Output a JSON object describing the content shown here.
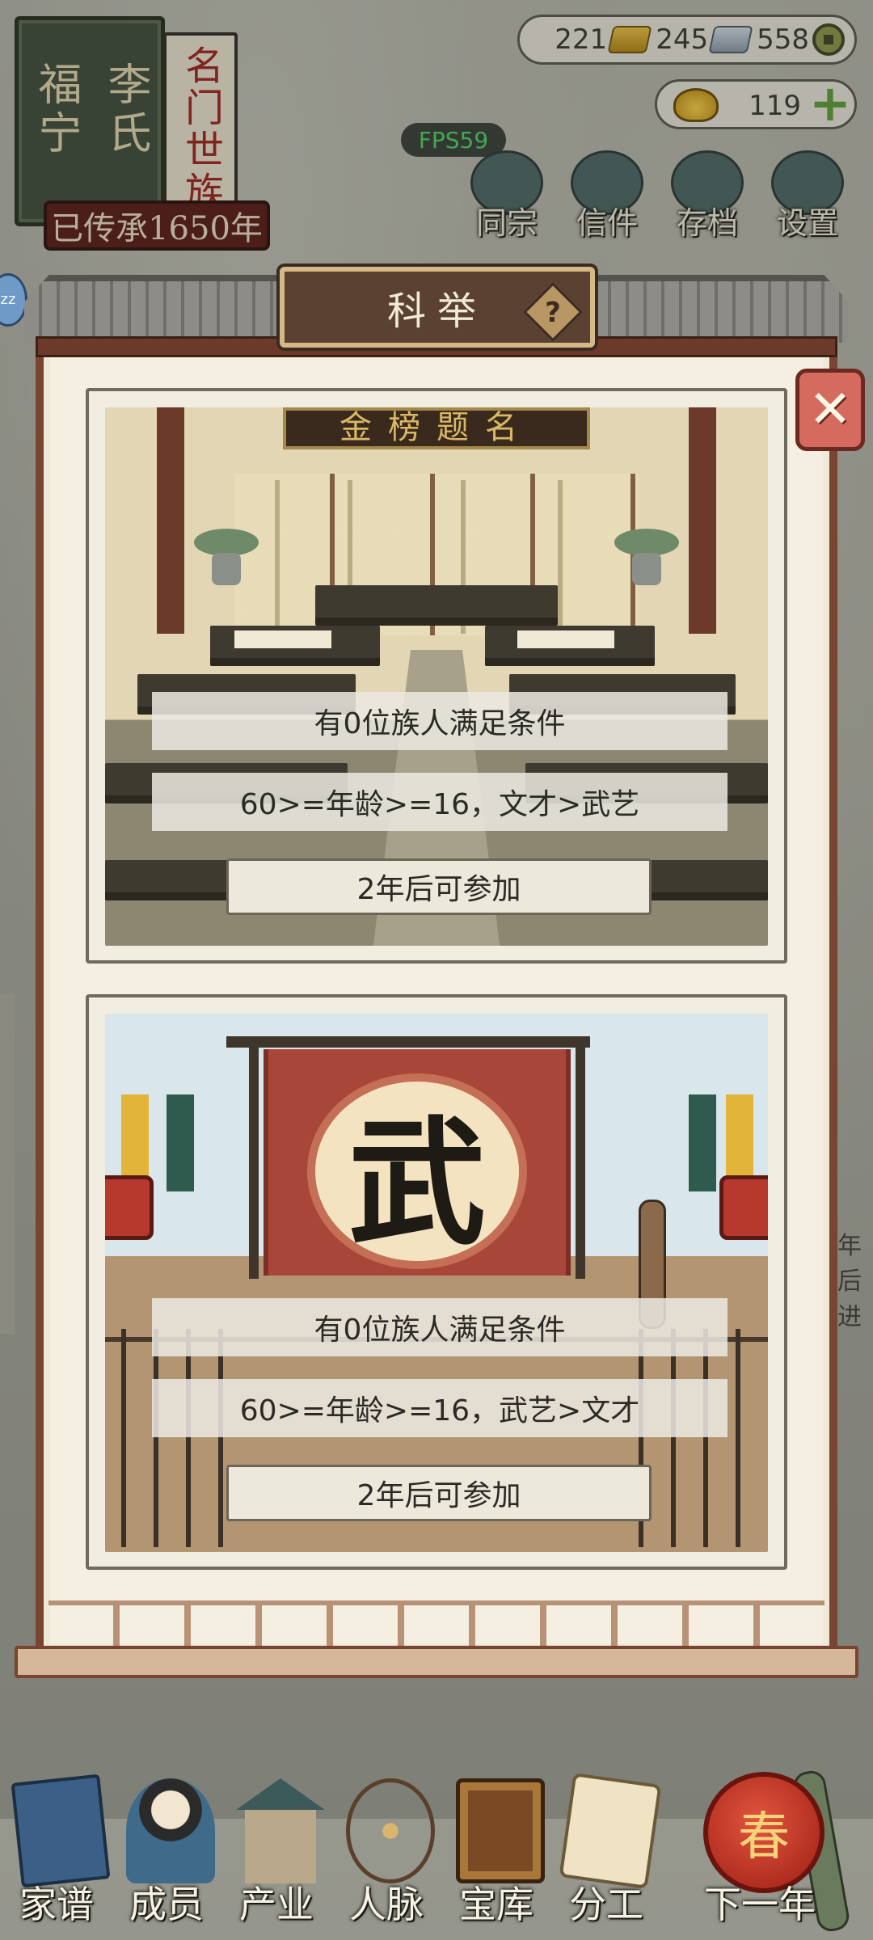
{
  "family": {
    "surname": "李氏",
    "location": "福宁",
    "title": "名门世族",
    "heritage": "已传承1650年"
  },
  "resources": {
    "gold": "221",
    "silver": "245",
    "coins": "558",
    "ingots": "119"
  },
  "fps": "FPS59",
  "top_menu": [
    {
      "label": "同宗",
      "icon": "clan-book-icon"
    },
    {
      "label": "信件",
      "icon": "letter-icon"
    },
    {
      "label": "存档",
      "icon": "save-scroll-icon"
    },
    {
      "label": "设置",
      "icon": "gear-icon"
    }
  ],
  "dialog": {
    "title": "科举",
    "help": "?",
    "close": "✕"
  },
  "exams": [
    {
      "type": "civil",
      "signboard": "金榜题名",
      "eligible": "有0位族人满足条件",
      "requirement": "60>=年龄>=16，文才>武艺",
      "action": "2年后可参加"
    },
    {
      "type": "martial",
      "emblem": "武",
      "eligible": "有0位族人满足条件",
      "requirement": "60>=年龄>=16，武艺>文才",
      "action": "2年后可参加"
    }
  ],
  "side_peek": {
    "right_text_1": "年后",
    "right_text_2": "进",
    "zz": "zz"
  },
  "bottom_nav": [
    {
      "label": "家谱",
      "icon": "genealogy-book-icon"
    },
    {
      "label": "成员",
      "icon": "member-portrait-icon"
    },
    {
      "label": "产业",
      "icon": "pavilion-icon"
    },
    {
      "label": "人脉",
      "icon": "network-icon"
    },
    {
      "label": "宝库",
      "icon": "treasure-chest-icon"
    },
    {
      "label": "分工",
      "icon": "scroll-icon"
    }
  ],
  "next_year": {
    "label": "下一年",
    "lantern_char": "春"
  },
  "colors": {
    "accent_red": "#a9463a",
    "panel_frame": "#7a4432",
    "paper": "#f4efe1",
    "fps_green": "#4cd964"
  }
}
